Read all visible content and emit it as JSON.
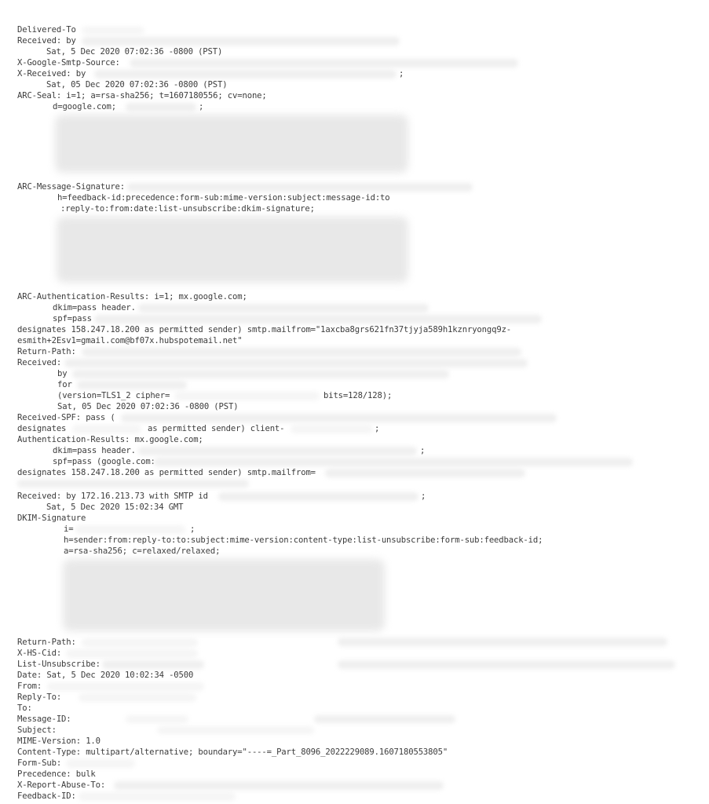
{
  "document": {
    "type": "email-original-headers",
    "lines": {
      "delivered_to": "Delivered-To",
      "received_1": "Received: by",
      "received_1_date": "Sat, 5 Dec 2020 07:02:36 -0800 (PST)",
      "x_google_smtp_source": "X-Google-Smtp-Source:",
      "x_received": "X-Received: by",
      "x_received_tail": ";",
      "x_received_date": "Sat, 05 Dec 2020 07:02:36 -0800 (PST)",
      "arc_seal": "ARC-Seal: i=1; a=rsa-sha256; t=1607180556; cv=none;",
      "arc_seal_d": "d=google.com;",
      "arc_seal_d_tail": ";",
      "arc_msg_sig": "ARC-Message-Signature:",
      "arc_msg_sig_h1": "h=feedback-id:precedence:form-sub:mime-version:subject:message-id:to",
      "arc_msg_sig_h2": ":reply-to:from:date:list-unsubscribe:dkim-signature;",
      "arc_auth": "ARC-Authentication-Results: i=1; mx.google.com;",
      "arc_auth_dkim": "dkim=pass header.",
      "arc_auth_spf": "spf=pass",
      "arc_auth_designates": "designates 158.247.18.200 as permitted sender) smtp.mailfrom=\"1axcba8grs621fn37tjyja589h1kznryongq9z-",
      "arc_auth_mailfrom_cont": "esmith+2Esv1=gmail.com@bf07x.hubspotemail.net\"",
      "return_path_1": "Return-Path:",
      "received_2": "Received:",
      "received_2_by": "by",
      "received_2_for": "for",
      "received_2_tls": "(version=TLS1_2 cipher=",
      "received_2_bits": "bits=128/128);",
      "received_2_date": "Sat, 05 Dec 2020 07:02:36 -0800 (PST)",
      "received_spf": "Received-SPF: pass (",
      "received_spf_designates": "designates",
      "received_spf_client": "as permitted sender) client-",
      "received_spf_tail": ";",
      "auth_results": "Authentication-Results: mx.google.com;",
      "auth_dkim": "dkim=pass header.",
      "auth_dkim_tail": ";",
      "auth_spf": "spf=pass (google.com:",
      "auth_designates": "designates 158.247.18.200 as permitted sender) smtp.mailfrom=",
      "received_3": "Received: by 172.16.213.73 with SMTP id",
      "received_3_tail": ";",
      "received_3_date": "Sat, 5 Dec 2020 15:02:34 GMT",
      "dkim_signature": "DKIM-Signature",
      "dkim_i": "i=",
      "dkim_i_tail": ";",
      "dkim_h": "h=sender:from:reply-to:to:subject:mime-version:content-type:list-unsubscribe:form-sub:feedback-id;",
      "dkim_a": "a=rsa-sha256; c=relaxed/relaxed;",
      "return_path_2": "Return-Path:",
      "x_hs_cid": "X-HS-Cid:",
      "list_unsubscribe": "List-Unsubscribe:",
      "date": "Date: Sat, 5 Dec 2020 10:02:34 -0500",
      "from": "From:",
      "reply_to": "Reply-To:",
      "to": "To:",
      "message_id": "Message-ID:",
      "subject": "Subject:",
      "mime_version": "MIME-Version: 1.0",
      "content_type": "Content-Type: multipart/alternative; boundary=\"----=_Part_8096_2022229089.1607180553805\"",
      "form_sub": "Form-Sub:",
      "precedence": "Precedence: bulk",
      "x_report_abuse_to": "X-Report-Abuse-To:",
      "feedback_id": "Feedback-ID:"
    }
  }
}
